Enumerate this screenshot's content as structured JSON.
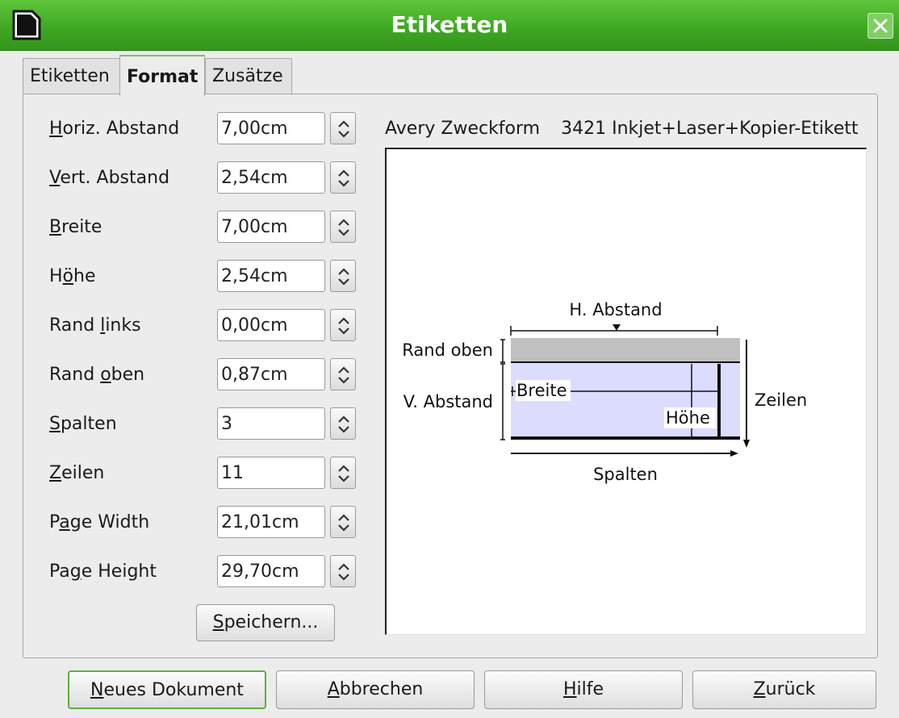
{
  "window": {
    "title": "Etiketten",
    "colors": {
      "titlebar": "#3fa823",
      "default_button_border": "#5fae42",
      "preview_label_fill": "#dcdcff",
      "preview_margin_fill": "#c0c0c0"
    }
  },
  "tabs": [
    {
      "label": "Etiketten",
      "active": false
    },
    {
      "label": "Format",
      "active": true
    },
    {
      "label": "Zusätze",
      "active": false
    }
  ],
  "fields": [
    {
      "label_mnemonic": "H",
      "label_rest": "oriz. Abstand",
      "value": "7,00cm"
    },
    {
      "label_mnemonic": "V",
      "label_rest": "ert. Abstand",
      "value": "2,54cm"
    },
    {
      "label_mnemonic": "B",
      "label_rest": "reite",
      "value": "7,00cm"
    },
    {
      "label_pre": "H",
      "label_mnemonic": "ö",
      "label_rest": "he",
      "value": "2,54cm"
    },
    {
      "label_pre": "Rand ",
      "label_mnemonic": "l",
      "label_rest": "inks",
      "value": "0,00cm"
    },
    {
      "label_pre": "Rand ",
      "label_mnemonic": "o",
      "label_rest": "ben",
      "value": "0,87cm"
    },
    {
      "label_mnemonic": "S",
      "label_rest": "palten",
      "value": "3"
    },
    {
      "label_mnemonic": "Z",
      "label_rest": "eilen",
      "value": "11"
    },
    {
      "label_pre": "P",
      "label_mnemonic": "a",
      "label_rest": "ge Width",
      "value": "21,01cm"
    },
    {
      "label_pre": "Pa",
      "label_mnemonic": "g",
      "label_rest": "e Height",
      "value": "29,70cm"
    }
  ],
  "save_button": {
    "mnemonic": "S",
    "rest": "peichern..."
  },
  "label_type": {
    "brand": "Avery Zweckform",
    "product": "3421 Inkjet+Laser+Kopier-Etikett"
  },
  "preview": {
    "h_abstand": "H. Abstand",
    "rand_oben": "Rand oben",
    "v_abstand": "V. Abstand",
    "breite": "Breite",
    "hoehe": "Höhe",
    "zeilen": "Zeilen",
    "spalten": "Spalten"
  },
  "buttons": {
    "new_doc": {
      "mnemonic": "N",
      "rest": "eues Dokument"
    },
    "cancel": {
      "mnemonic": "A",
      "rest": "bbrechen"
    },
    "help": {
      "mnemonic": "H",
      "rest": "ilfe"
    },
    "back": {
      "mnemonic": "Z",
      "rest": "urück"
    }
  }
}
